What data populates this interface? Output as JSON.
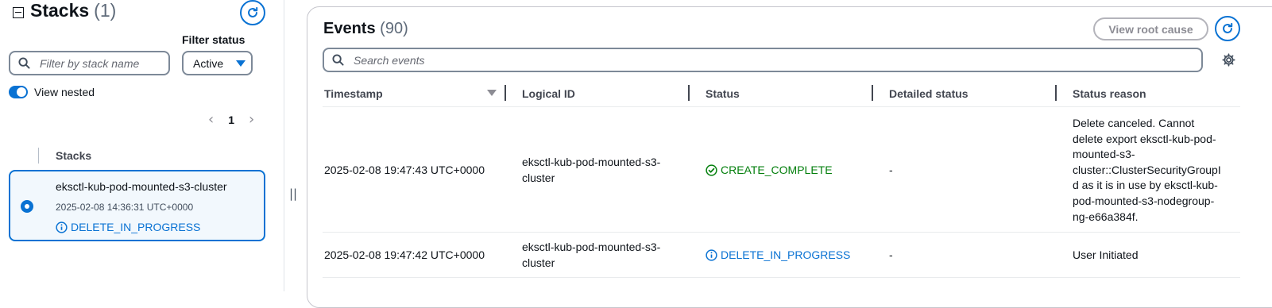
{
  "stacks_panel": {
    "title": "Stacks",
    "count": "(1)",
    "filter_status_label": "Filter status",
    "search_placeholder": "Filter by stack name",
    "filter_status_value": "Active",
    "view_nested_label": "View nested",
    "view_nested_on": true,
    "page_number": "1",
    "column_header": "Stacks",
    "selected_stack": {
      "name": "eksctl-kub-pod-mounted-s3-cluster",
      "timestamp": "2025-02-08 14:36:31 UTC+0000",
      "status": "DELETE_IN_PROGRESS"
    }
  },
  "events_panel": {
    "title": "Events",
    "count": "(90)",
    "view_root_cause_label": "View root cause",
    "search_placeholder": "Search events",
    "columns": [
      "Timestamp",
      "Logical ID",
      "Status",
      "Detailed status",
      "Status reason"
    ],
    "rows": [
      {
        "timestamp": "2025-02-08 19:47:43 UTC+0000",
        "logical_id_line1": "eksctl-kub-pod-mounted-s3-",
        "logical_id_line2": "cluster",
        "status": "CREATE_COMPLETE",
        "status_kind": "success",
        "detailed_status": "-",
        "status_reason_lines": [
          "Delete canceled. Cannot",
          "delete export eksctl-kub-pod-",
          "mounted-s3-",
          "cluster::ClusterSecurityGroupI",
          "d as it is in use by eksctl-kub-",
          "pod-mounted-s3-nodegroup-",
          "ng-e66a384f."
        ]
      },
      {
        "timestamp": "2025-02-08 19:47:42 UTC+0000",
        "logical_id_line1": "eksctl-kub-pod-mounted-s3-",
        "logical_id_line2": "cluster",
        "status": "DELETE_IN_PROGRESS",
        "status_kind": "info",
        "detailed_status": "-",
        "status_reason_lines": [
          "User Initiated"
        ]
      }
    ]
  },
  "colors": {
    "accent": "#0972d3",
    "success": "#037f0c",
    "disabled": "#8c8c94"
  },
  "icons": {
    "refresh": "refresh-icon",
    "search": "search-icon",
    "settings": "gear-icon",
    "info": "info-icon",
    "success": "check-circle-icon"
  }
}
